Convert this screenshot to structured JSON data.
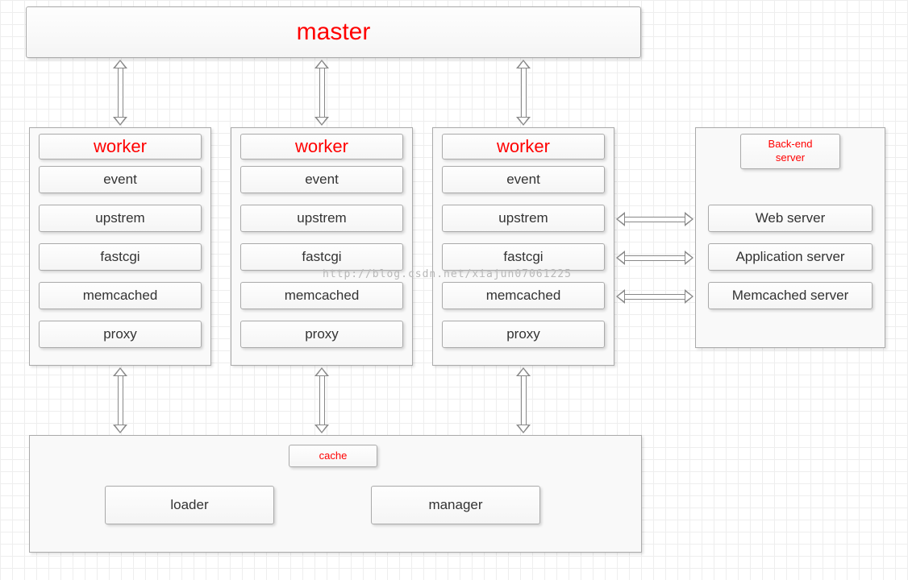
{
  "master": {
    "title": "master"
  },
  "workers": [
    {
      "title": "worker",
      "items": [
        "event",
        "upstrem",
        "fastcgi",
        "memcached",
        "proxy"
      ]
    },
    {
      "title": "worker",
      "items": [
        "event",
        "upstrem",
        "fastcgi",
        "memcached",
        "proxy"
      ]
    },
    {
      "title": "worker",
      "items": [
        "event",
        "upstrem",
        "fastcgi",
        "memcached",
        "proxy"
      ]
    }
  ],
  "backend": {
    "title": "Back-end\nserver",
    "servers": [
      "Web server",
      "Application server",
      "Memcached server"
    ]
  },
  "cache": {
    "title": "cache",
    "items": [
      "loader",
      "manager"
    ]
  },
  "watermark": "http://blog.csdn.net/xiajun07061225"
}
